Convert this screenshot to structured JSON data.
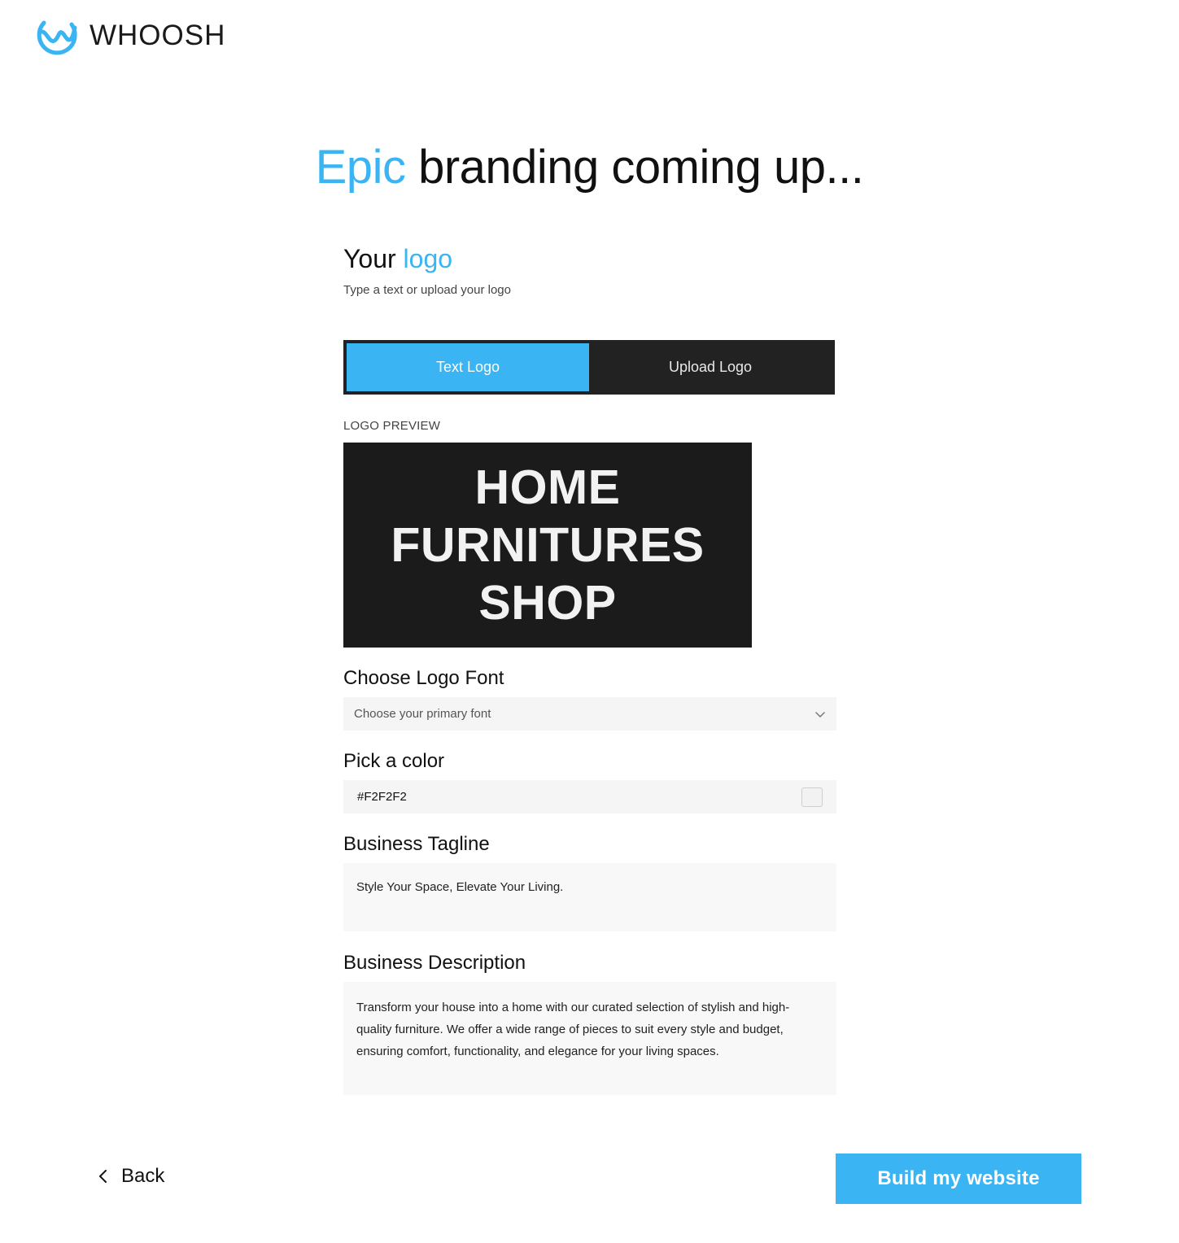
{
  "brand": {
    "name": "WHOOSH",
    "icon": "whoosh-wave-logo",
    "color": "#3ab4f2"
  },
  "headline": {
    "accent": "Epic",
    "rest": " branding coming up..."
  },
  "logo_section": {
    "title_prefix": "Your ",
    "title_accent": "logo",
    "subtitle": "Type a text or upload your logo"
  },
  "tabs": [
    {
      "label": "Text Logo",
      "active": true
    },
    {
      "label": "Upload Logo",
      "active": false
    }
  ],
  "preview": {
    "label": "LOGO PREVIEW",
    "lines": [
      "HOME",
      "FURNITURES",
      "SHOP"
    ]
  },
  "font": {
    "label": "Choose Logo Font",
    "placeholder": "Choose your primary font",
    "icon": "chevron-down-icon"
  },
  "color": {
    "label": "Pick a color",
    "value": "#F2F2F2"
  },
  "tagline": {
    "label": "Business Tagline",
    "value": "Style Your Space, Elevate Your Living."
  },
  "description": {
    "label": "Business Description",
    "value": "Transform your house into a home with our curated selection of stylish and high-quality furniture. We offer a wide range of pieces to suit every style and budget, ensuring comfort, functionality, and elegance for your living spaces."
  },
  "footer": {
    "back_label": "Back",
    "back_icon": "chevron-left-icon",
    "build_label": "Build my website"
  },
  "colors": {
    "accent": "#3ab4f2",
    "dark": "#1b1b1b",
    "field_bg": "#f5f5f5"
  }
}
